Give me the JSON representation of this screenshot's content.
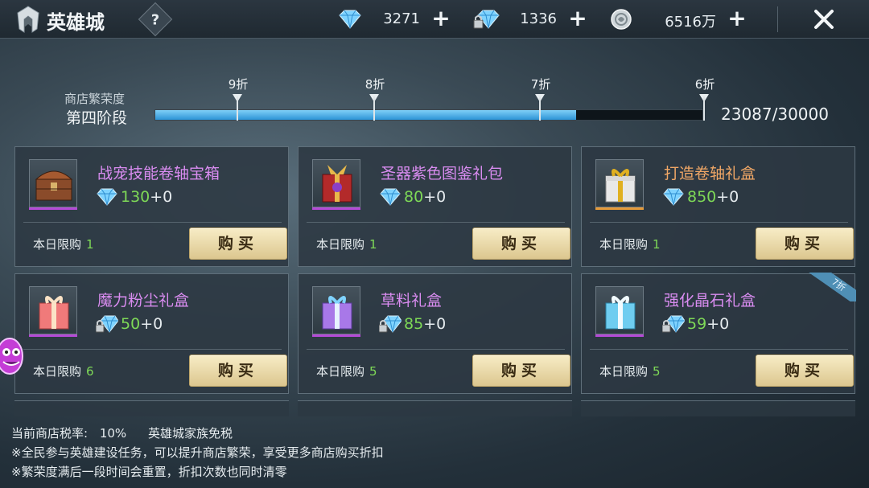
{
  "header": {
    "title": "英雄城",
    "help_label": "?",
    "currencies": [
      {
        "icon": "diamond-icon",
        "value": "3271",
        "add": "+"
      },
      {
        "icon": "bound-diamond-icon",
        "value": "1336",
        "add": "+"
      },
      {
        "icon": "silver-coin-icon",
        "value": "6516万",
        "add": "+"
      }
    ]
  },
  "prosperity": {
    "label": "商店繁荣度",
    "stage": "第四阶段",
    "markers": [
      "9折",
      "8折",
      "7折",
      "6折"
    ],
    "current": 23087,
    "max": 30000,
    "display": "23087/30000",
    "fill_ratio": 0.77
  },
  "items": [
    {
      "name": "战宠技能卷轴宝箱",
      "name_color": "#d98cf0",
      "currency": "diamond",
      "price": "130",
      "bonus": "+0",
      "limit_label": "本日限购",
      "limit": "1",
      "buy": "购买"
    },
    {
      "name": "圣器紫色图鉴礼包",
      "name_color": "#d98cf0",
      "currency": "diamond",
      "price": "80",
      "bonus": "+0",
      "limit_label": "本日限购",
      "limit": "1",
      "buy": "购买"
    },
    {
      "name": "打造卷轴礼盒",
      "name_color": "#f0a766",
      "currency": "diamond",
      "price": "850",
      "bonus": "+0",
      "limit_label": "本日限购",
      "limit": "1",
      "buy": "购买"
    },
    {
      "name": "魔力粉尘礼盒",
      "name_color": "#d98cf0",
      "currency": "bound-diamond",
      "price": "50",
      "bonus": "+0",
      "limit_label": "本日限购",
      "limit": "6",
      "buy": "购买"
    },
    {
      "name": "草料礼盒",
      "name_color": "#d98cf0",
      "currency": "bound-diamond",
      "price": "85",
      "bonus": "+0",
      "limit_label": "本日限购",
      "limit": "5",
      "buy": "购买"
    },
    {
      "name": "强化晶石礼盒",
      "name_color": "#d98cf0",
      "currency": "bound-diamond",
      "price": "59",
      "bonus": "+0",
      "limit_label": "本日限购",
      "limit": "5",
      "buy": "购买",
      "badge": "7折"
    }
  ],
  "footer": {
    "tax_label": "当前商店税率:",
    "tax_value": "10%",
    "tax_note": "英雄城家族免税",
    "tip1": "※全民参与英雄建设任务，可以提升商店繁荣，享受更多商店购买折扣",
    "tip2": "※繁荣度满后一段时间会重置，折扣次数也同时清零"
  }
}
